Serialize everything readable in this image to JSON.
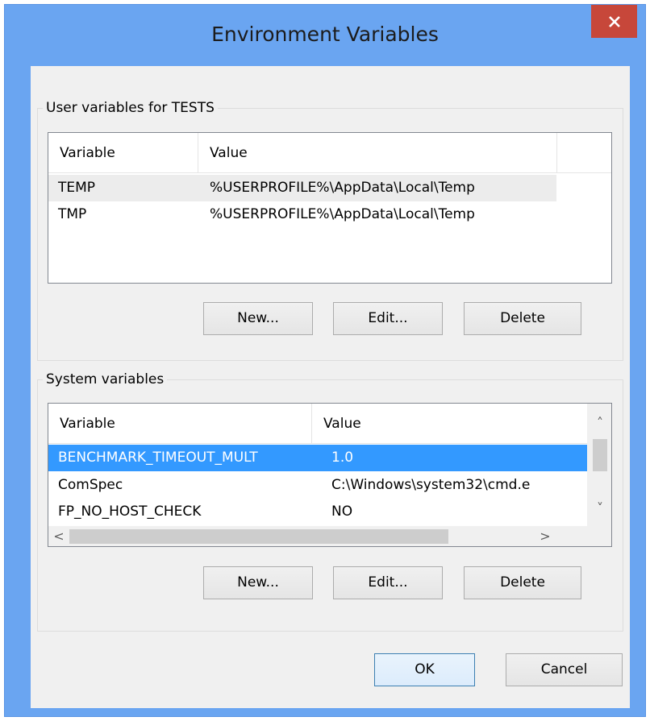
{
  "window": {
    "title": "Environment Variables",
    "close_glyph": "✕"
  },
  "user_group": {
    "label": "User variables for TESTS",
    "columns": [
      "Variable",
      "Value"
    ],
    "rows": [
      {
        "variable": "TEMP",
        "value": "%USERPROFILE%\\AppData\\Local\\Temp"
      },
      {
        "variable": "TMP",
        "value": "%USERPROFILE%\\AppData\\Local\\Temp"
      }
    ],
    "buttons": {
      "new": "New...",
      "edit": "Edit...",
      "delete": "Delete"
    }
  },
  "system_group": {
    "label": "System variables",
    "columns": [
      "Variable",
      "Value"
    ],
    "rows": [
      {
        "variable": "BENCHMARK_TIMEOUT_MULT",
        "value": "1.0"
      },
      {
        "variable": "ComSpec",
        "value": "C:\\Windows\\system32\\cmd.e"
      },
      {
        "variable": "FP_NO_HOST_CHECK",
        "value": "NO"
      }
    ],
    "selected_row": "BENCHMARK_TIMEOUT_MULT",
    "buttons": {
      "new": "New...",
      "edit": "Edit...",
      "delete": "Delete"
    },
    "scroll": {
      "up": "˄",
      "down": "˅",
      "left": "<",
      "right": ">"
    }
  },
  "footer": {
    "ok": "OK",
    "cancel": "Cancel"
  },
  "colors": {
    "title_bar": "#6aa5f1",
    "close": "#c7473a",
    "selection": "#3399ff"
  }
}
